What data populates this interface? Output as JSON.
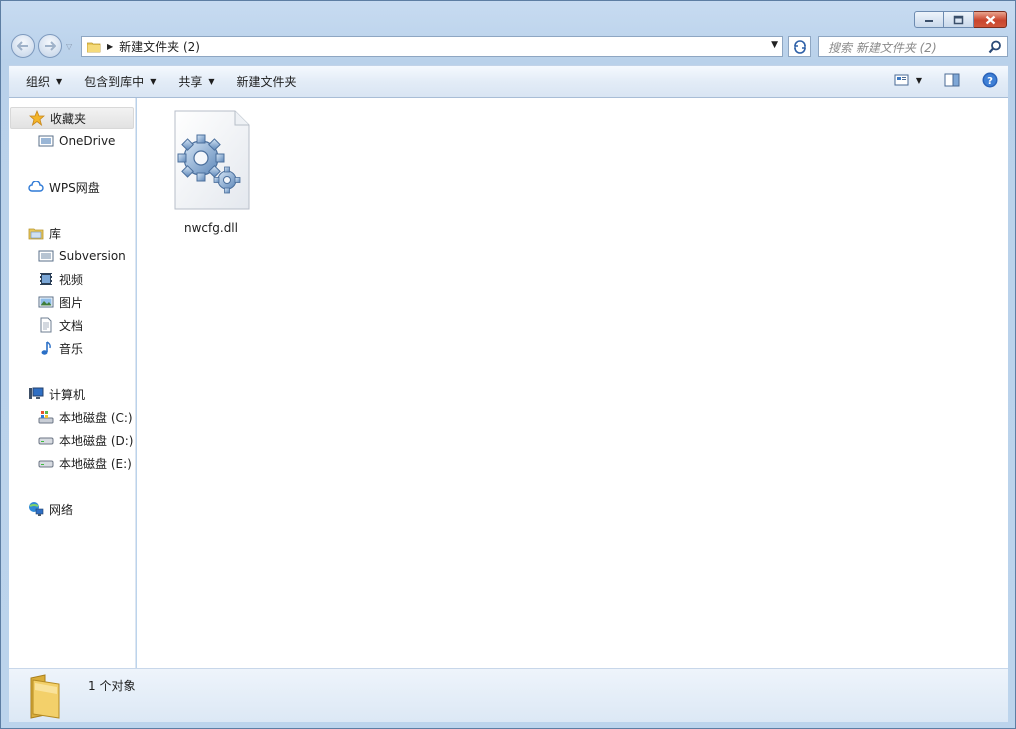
{
  "window": {
    "caption_buttons": [
      "minimize",
      "maximize",
      "close"
    ]
  },
  "address_bar": {
    "path_segment": "新建文件夹 (2)"
  },
  "search": {
    "placeholder": "搜索 新建文件夹 (2)"
  },
  "toolbar": {
    "organize": "组织",
    "include_in_library": "包含到库中",
    "share": "共享",
    "new_folder": "新建文件夹"
  },
  "sidebar": {
    "favorites": "收藏夹",
    "onedrive": "OneDrive",
    "wps_drive": "WPS网盘",
    "libraries": "库",
    "subversion": "Subversion",
    "videos": "视频",
    "pictures": "图片",
    "documents": "文档",
    "music": "音乐",
    "computer": "计算机",
    "drive_c": "本地磁盘 (C:)",
    "drive_d": "本地磁盘 (D:)",
    "drive_e": "本地磁盘 (E:)",
    "network": "网络"
  },
  "files": [
    {
      "name": "nwcfg.dll",
      "icon": "dll-gear-icon"
    }
  ],
  "status": {
    "count_text": "1 个对象"
  },
  "colors": {
    "frame": "#b9d1ea",
    "selection": "#e2e2e2",
    "close_button": "#c9452d"
  }
}
